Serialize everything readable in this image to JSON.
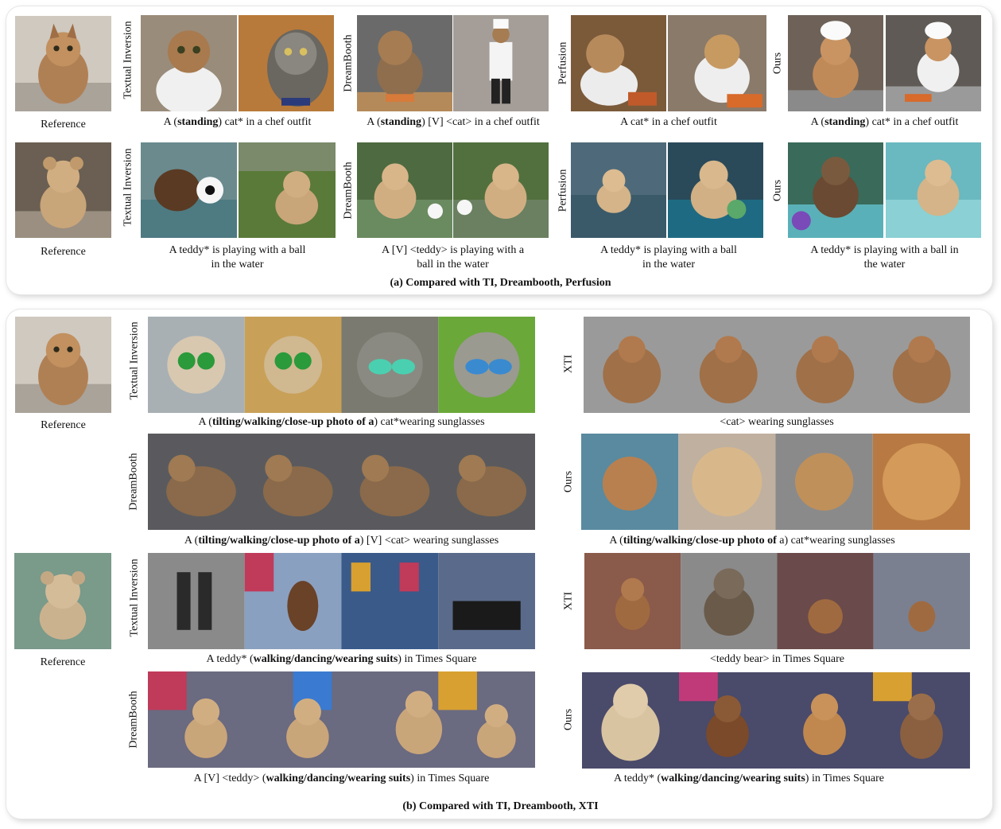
{
  "panel_a": {
    "caption": "(a) Compared with TI, Dreambooth, Perfusion",
    "row1": {
      "reference_label": "Reference",
      "methods": [
        "Textual Inversion",
        "DreamBooth",
        "Perfusion",
        "Ours"
      ],
      "captions": [
        {
          "pre": "A (",
          "bold": "standing",
          "post": ") cat* in a chef outfit"
        },
        {
          "pre": "A (",
          "bold": "standing",
          "post": ") [V] <cat>  in a chef outfit"
        },
        {
          "pre": "A cat* in a chef outfit",
          "bold": "",
          "post": ""
        },
        {
          "pre": "A (",
          "bold": "standing",
          "post": ") cat* in a chef outfit"
        }
      ]
    },
    "row2": {
      "reference_label": "Reference",
      "methods": [
        "Textual Inversion",
        "DreamBooth",
        "Perfusion",
        "Ours"
      ],
      "captions": [
        [
          "A teddy* is playing with a ball",
          "in the water"
        ],
        [
          "A [V] <teddy> is playing with a",
          "ball in the water"
        ],
        [
          "A teddy* is playing with a ball",
          "in the water"
        ],
        [
          "A teddy* is playing with a ball in",
          "the water"
        ]
      ]
    }
  },
  "panel_b": {
    "caption": "(b) Compared with TI, Dreambooth, XTI",
    "cat": {
      "reference_label": "Reference",
      "ti_label": "Textual Inversion",
      "ti_caption": {
        "pre": "A  (",
        "bold": "tilting/walking/close-up photo of a",
        "post": ") cat*wearing sunglasses"
      },
      "db_label": "DreamBooth",
      "db_caption": {
        "pre": "A  (",
        "bold": "tilting/walking/close-up photo of a",
        "post": ") [V] <cat> wearing sunglasses"
      },
      "xti_label": "XTI",
      "xti_caption": {
        "pre": "<cat> wearing sunglasses",
        "bold": "",
        "post": ""
      },
      "ours_label": "Ours",
      "ours_caption": {
        "pre": "A  (",
        "bold": "tilting/walking/close-up photo of",
        "post": " a) cat*wearing sunglasses"
      }
    },
    "teddy": {
      "reference_label": "Reference",
      "ti_label": "Textual Inversion",
      "ti_caption": {
        "pre": "A teddy* (",
        "bold": "walking/dancing/wearing suits",
        "post": ") in Times Square"
      },
      "db_label": "DreamBooth",
      "db_caption": {
        "pre": "A [V] <teddy> (",
        "bold": "walking/dancing/wearing suits",
        "post": ") in Times Square"
      },
      "xti_label": "XTI",
      "xti_caption": {
        "pre": "<teddy bear> in Times Square",
        "bold": "",
        "post": ""
      },
      "ours_label": "Ours",
      "ours_caption": {
        "pre": "A teddy* (",
        "bold": "walking/dancing/wearing suits",
        "post": ") in Times Square"
      }
    }
  },
  "colors": {
    "cat_fur": "#b08055",
    "teddy_fur": "#c9a57a",
    "kitchen": "#7a6a5a",
    "water": "#5a9aa8",
    "street": "#6a6a78",
    "panel_border": "#e6e6e6"
  }
}
